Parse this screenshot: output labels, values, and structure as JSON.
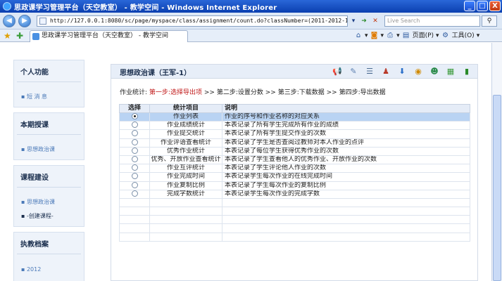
{
  "window": {
    "title": "思政课学习管理平台（天空教室） - 教学空间 - Windows Internet Explorer",
    "min": "_",
    "max": "□",
    "close": "X"
  },
  "browser": {
    "address": "http://127.0.0.1:8080/sc/page/myspace/class/assignment/count.do?classNumber=(2011-2012-1)-27984494-1",
    "search_placeholder": "Live Search",
    "tab_title": "思政课学习管理平台（天空教室） - 教学空间",
    "tools": {
      "page": "页面(P)",
      "tools": "工具(O)"
    }
  },
  "sidebar": {
    "sections": [
      {
        "title": "个人功能",
        "items": [
          "短 消 息"
        ]
      },
      {
        "title": "本期授课",
        "items": [
          "思想政治课"
        ]
      },
      {
        "title": "课程建设",
        "items": [
          "思想政治课",
          "-创建课程-"
        ]
      },
      {
        "title": "执教档案",
        "items": [
          "2012"
        ]
      }
    ]
  },
  "main": {
    "title": "思想政治课（王军-1）",
    "steps": {
      "label": "作业统计:",
      "step1": "第一步:选择导出项",
      "sep": ">>",
      "step2": "第二步:设置分数",
      "step3": "第三步:下载数据",
      "step4": "第四步:导出数据"
    },
    "table": {
      "headers": {
        "select": "选择",
        "item": "统计项目",
        "desc": "说明"
      },
      "rows": [
        {
          "item": "作业列表",
          "desc": "作业的序号和作业名称的对应关系",
          "selected": true
        },
        {
          "item": "作业成绩统计",
          "desc": "本表记录了所有学生完成所有作业的成绩",
          "selected": false
        },
        {
          "item": "作业提交统计",
          "desc": "本表记录了所有学生提交作业的次数",
          "selected": false
        },
        {
          "item": "作业评语查看统计",
          "desc": "本表记录了学生是否查阅过教师对本人作业的点评",
          "selected": false
        },
        {
          "item": "优秀作业统计",
          "desc": "本表记录了每位学生获得优秀作业的次数",
          "selected": false
        },
        {
          "item": "优秀、开放作业查看统计",
          "desc": "本表记录了学生查看他人的优秀作业、开放作业的次数",
          "selected": false
        },
        {
          "item": "作业互评统计",
          "desc": "本表记录了学生评论他人作业的次数",
          "selected": false
        },
        {
          "item": "作业完成时间",
          "desc": "本表记录学生每次作业的在线完成时间",
          "selected": false
        },
        {
          "item": "作业复制比例",
          "desc": "本表记录了学生每次作业的复制比例",
          "selected": false
        },
        {
          "item": "完成字数统计",
          "desc": "本表记录学生每次作业的完成字数",
          "selected": false
        }
      ],
      "empty_rows": 5
    }
  }
}
